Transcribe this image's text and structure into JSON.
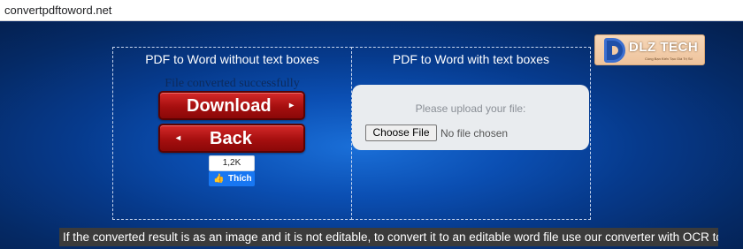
{
  "browser": {
    "url": "convertpdftoword.net"
  },
  "logo": {
    "name": "DLZ TECH",
    "tagline": "Cùng Bạn Kiến Tạo Giá Trị Số"
  },
  "left_panel": {
    "title": "PDF to Word without text boxes",
    "status": "File converted successfully",
    "download_label": "Download",
    "back_label": "Back",
    "like_count": "1,2K",
    "like_label": "Thích"
  },
  "right_panel": {
    "title": "PDF to Word with text boxes",
    "upload_prompt": "Please upload your file:",
    "choose_file_label": "Choose File",
    "no_file_text": "No file chosen"
  },
  "footer_note": "If the converted result is as an image and it is not editable, to convert it to an editable word file use our converter with OCR tool.",
  "icons": {
    "download_arrow": "chevron-right-icon",
    "back_arrow": "chevron-left-icon",
    "like": "thumbs-up-icon",
    "logo": "dlz-logo-icon"
  },
  "colors": {
    "button_red": "#b31515",
    "facebook_blue": "#1877f2",
    "background_blue": "#0b4fb3"
  }
}
